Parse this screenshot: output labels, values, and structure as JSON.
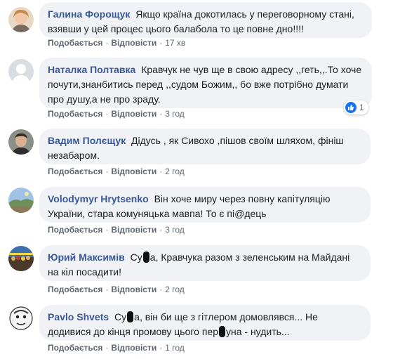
{
  "actions": {
    "like": "Подобається",
    "reply": "Відповісти",
    "sep": "·"
  },
  "colors": {
    "bubble": "#f0f2f5",
    "author": "#385898",
    "meta": "#606770",
    "like_blue": "#1877f2"
  },
  "comments": [
    {
      "author": "Галина Форощук",
      "text": "Якщо країна докотилась у переговорному стані, взявши у цей процес цього балабола то це повне дно!!!!",
      "time": "17 хв",
      "avatar": "woman-photo"
    },
    {
      "author": "Наталка Полтавка",
      "text": "Кравчук не чув ще в свою адресу ,,геть,,.То хоче почути,знанбитись перед ,,судом Божим,, бо вже потрібно думати про душу,а не про зраду.",
      "time": "3 год",
      "avatar": "default-avatar",
      "reaction": {
        "icon": "like-icon",
        "count": "1"
      }
    },
    {
      "author": "Вадим Полєщук",
      "text": "Дідусь , як Сивохо ,пішов своїм шляхом, фініш незабаром.",
      "time": "2 год",
      "avatar": "man-photo"
    },
    {
      "author": "Volodymyr Hrytsenko",
      "text": "Він хоче миру через повну капітуляцію України, стара комуняцька мавпа! То є пі@дець",
      "time": "3 год",
      "avatar": "landscape-photo"
    },
    {
      "author": "Юрий Максимів",
      "text_a": "Су",
      "text_b": "а, Кравчука разом з зеленським на Майдані на кіл посадити!",
      "time": "2 год",
      "avatar": "crowd-photo"
    },
    {
      "author": "Pavlo Shvets",
      "text_a": "Су",
      "text_b": "а, він би ще з гітлером домовлявся... Не додивися до кінця промову цього пер",
      "text_c": "уна - нудить...",
      "time": "1 год",
      "avatar": "cartoon-face"
    }
  ]
}
